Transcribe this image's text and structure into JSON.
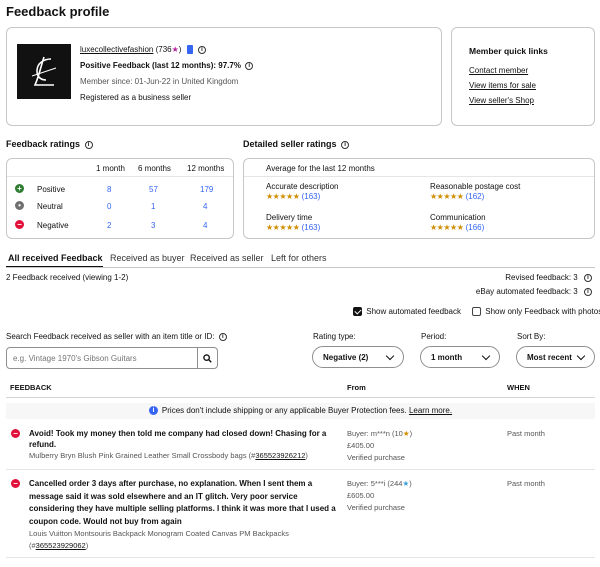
{
  "page_title": "Feedback profile",
  "profile": {
    "username": "luxecollectivefashion",
    "score": "(736",
    "score_close": ")",
    "positive_feedback": "Positive Feedback (last 12 months): 97.7%",
    "member_since": "Member since: 01-Jun-22 in United Kingdom",
    "business": "Registered as a business seller"
  },
  "quick_links": {
    "title": "Member quick links",
    "items": [
      "Contact member",
      "View items for sale",
      "View seller's Shop"
    ]
  },
  "ratings": {
    "title": "Feedback ratings",
    "columns": [
      "1 month",
      "6 months",
      "12 months"
    ],
    "rows": [
      {
        "label": "Positive",
        "values": [
          "8",
          "57",
          "179"
        ]
      },
      {
        "label": "Neutral",
        "values": [
          "0",
          "1",
          "4"
        ]
      },
      {
        "label": "Negative",
        "values": [
          "2",
          "3",
          "4"
        ]
      }
    ]
  },
  "detailed": {
    "title": "Detailed seller ratings",
    "subtitle": "Average for the last 12 months",
    "items": [
      {
        "label": "Accurate description",
        "stars": "★★★★★",
        "count": "(163)"
      },
      {
        "label": "Reasonable postage cost",
        "stars": "★★★★★",
        "count": "(162)"
      },
      {
        "label": "Delivery time",
        "stars": "★★★★★",
        "count": "(163)"
      },
      {
        "label": "Communication",
        "stars": "★★★★★",
        "count": "(166)"
      }
    ]
  },
  "tabs": [
    "All received Feedback",
    "Received as buyer",
    "Received as seller",
    "Left for others"
  ],
  "summary": {
    "received": "2 Feedback received (viewing 1-2)",
    "revised": "Revised feedback: 3",
    "automated": "eBay automated feedback: 3"
  },
  "filters": {
    "show_automated": "Show automated feedback",
    "show_photos": "Show only Feedback with photos",
    "search_label": "Search Feedback received as seller with an item title or ID:",
    "search_placeholder": "e.g. Vintage 1970's Gibson Guitars",
    "rating_label": "Rating type:",
    "rating_value": "Negative (2)",
    "period_label": "Period:",
    "period_value": "1 month",
    "sort_label": "Sort By:",
    "sort_value": "Most recent"
  },
  "table": {
    "headers": [
      "FEEDBACK",
      "From",
      "WHEN"
    ],
    "notice": "Prices don't include shipping or any applicable Buyer Protection fees.",
    "notice_link": "Learn more.",
    "rows": [
      {
        "text": "Avoid! Took my money then told me company had closed down! Chasing for a refund.",
        "item": "Mulberry Bryn Blush Pink Grained Leather Small Crossbody bags (#",
        "item_id": "365523926212",
        "item_close": ")",
        "buyer": "Buyer: m***n (10",
        "buyer_close": ")",
        "price": "£405.00",
        "verified": "Verified purchase",
        "when": "Past month"
      },
      {
        "text": "Cancelled order 3 days after purchase, no explanation. When I sent them a message said it was sold elsewhere and an IT glitch. Very poor service considering they have multiple selling platforms. I think it was more that I used a coupon code. Would not buy from again",
        "item": "Louis Vuitton Montsouris Backpack Monogram Coated Canvas PM Backpacks",
        "item_id": "365523929062",
        "item_open": "(#",
        "item_close": ")",
        "buyer": "Buyer: 5***i (244",
        "buyer_close": ")",
        "price": "£605.00",
        "verified": "Verified purchase",
        "when": "Past month"
      }
    ]
  },
  "colors": {
    "accent": "#3665f3",
    "positive": "#2e7d32",
    "neutral": "#707070",
    "negative": "#e0103a",
    "star": "#d08d00"
  }
}
